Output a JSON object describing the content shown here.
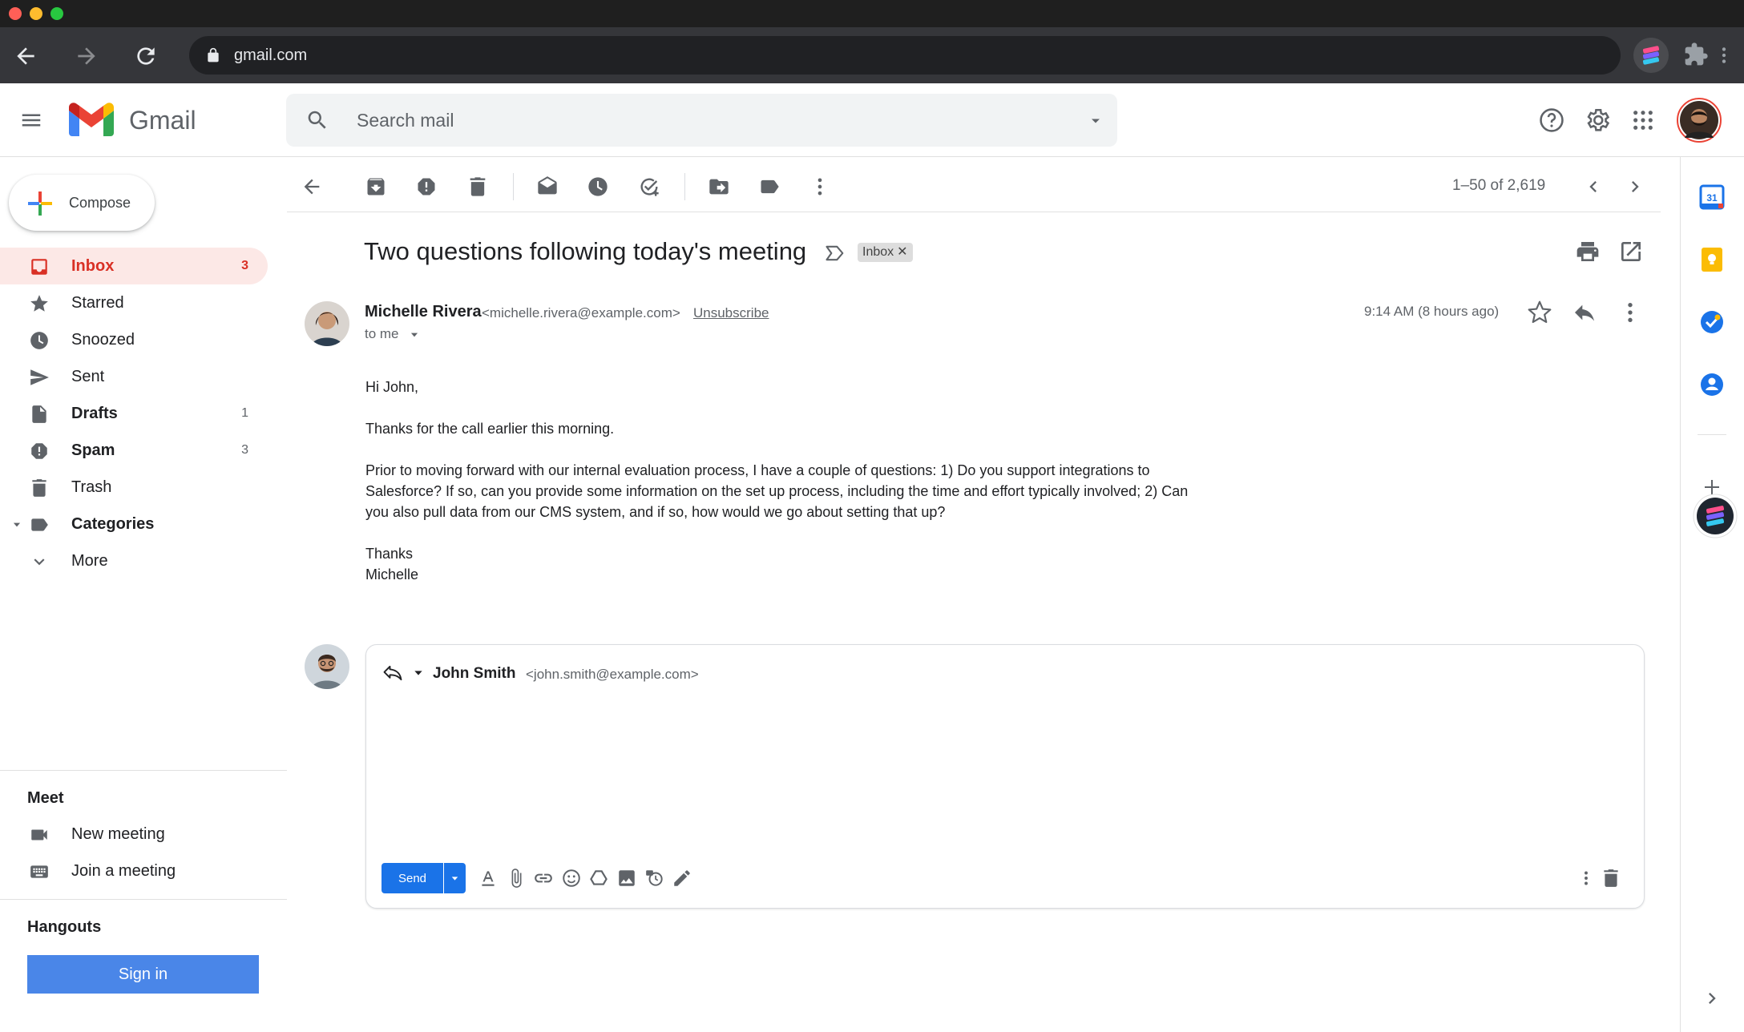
{
  "browser": {
    "url": "gmail.com"
  },
  "app": {
    "name": "Gmail"
  },
  "search": {
    "placeholder": "Search mail"
  },
  "compose": {
    "label": "Compose"
  },
  "nav": {
    "items": [
      {
        "label": "Inbox",
        "count": "3"
      },
      {
        "label": "Starred",
        "count": ""
      },
      {
        "label": "Snoozed",
        "count": ""
      },
      {
        "label": "Sent",
        "count": ""
      },
      {
        "label": "Drafts",
        "count": "1"
      },
      {
        "label": "Spam",
        "count": "3"
      },
      {
        "label": "Trash",
        "count": ""
      },
      {
        "label": "Categories",
        "count": ""
      },
      {
        "label": "More",
        "count": ""
      }
    ]
  },
  "meet": {
    "title": "Meet",
    "new_meeting": "New meeting",
    "join_meeting": "Join a meeting"
  },
  "hangouts": {
    "title": "Hangouts",
    "sign_in": "Sign in"
  },
  "toolbar": {
    "pagination": "1–50 of 2,619"
  },
  "message": {
    "subject": "Two questions following today's meeting",
    "label_chip": "Inbox",
    "label_chip_close": "✕",
    "sender_name": "Michelle Rivera",
    "sender_email": "<michelle.rivera@example.com>",
    "unsubscribe": "Unsubscribe",
    "recipient": "to me",
    "timestamp": "9:14 AM (8 hours ago)",
    "body": [
      "Hi John,",
      "Thanks for the call earlier this morning.",
      "Prior to moving forward with our internal evaluation process, I have a couple of questions: 1) Do you support integrations to",
      "Salesforce? If so, can you provide some information on the set up process, including the time and effort typically involved; 2) Can",
      "you also pull data from our CMS system, and if so, how would we go about setting that up?",
      "Thanks",
      "Michelle"
    ]
  },
  "reply": {
    "name": "John Smith",
    "email": "<john.smith@example.com>",
    "send_label": "Send"
  },
  "colors": {
    "accent_blue": "#1a73e8",
    "inbox_red": "#d93025",
    "active_bg": "#fce8e6",
    "chrome_dark": "#35363a"
  }
}
